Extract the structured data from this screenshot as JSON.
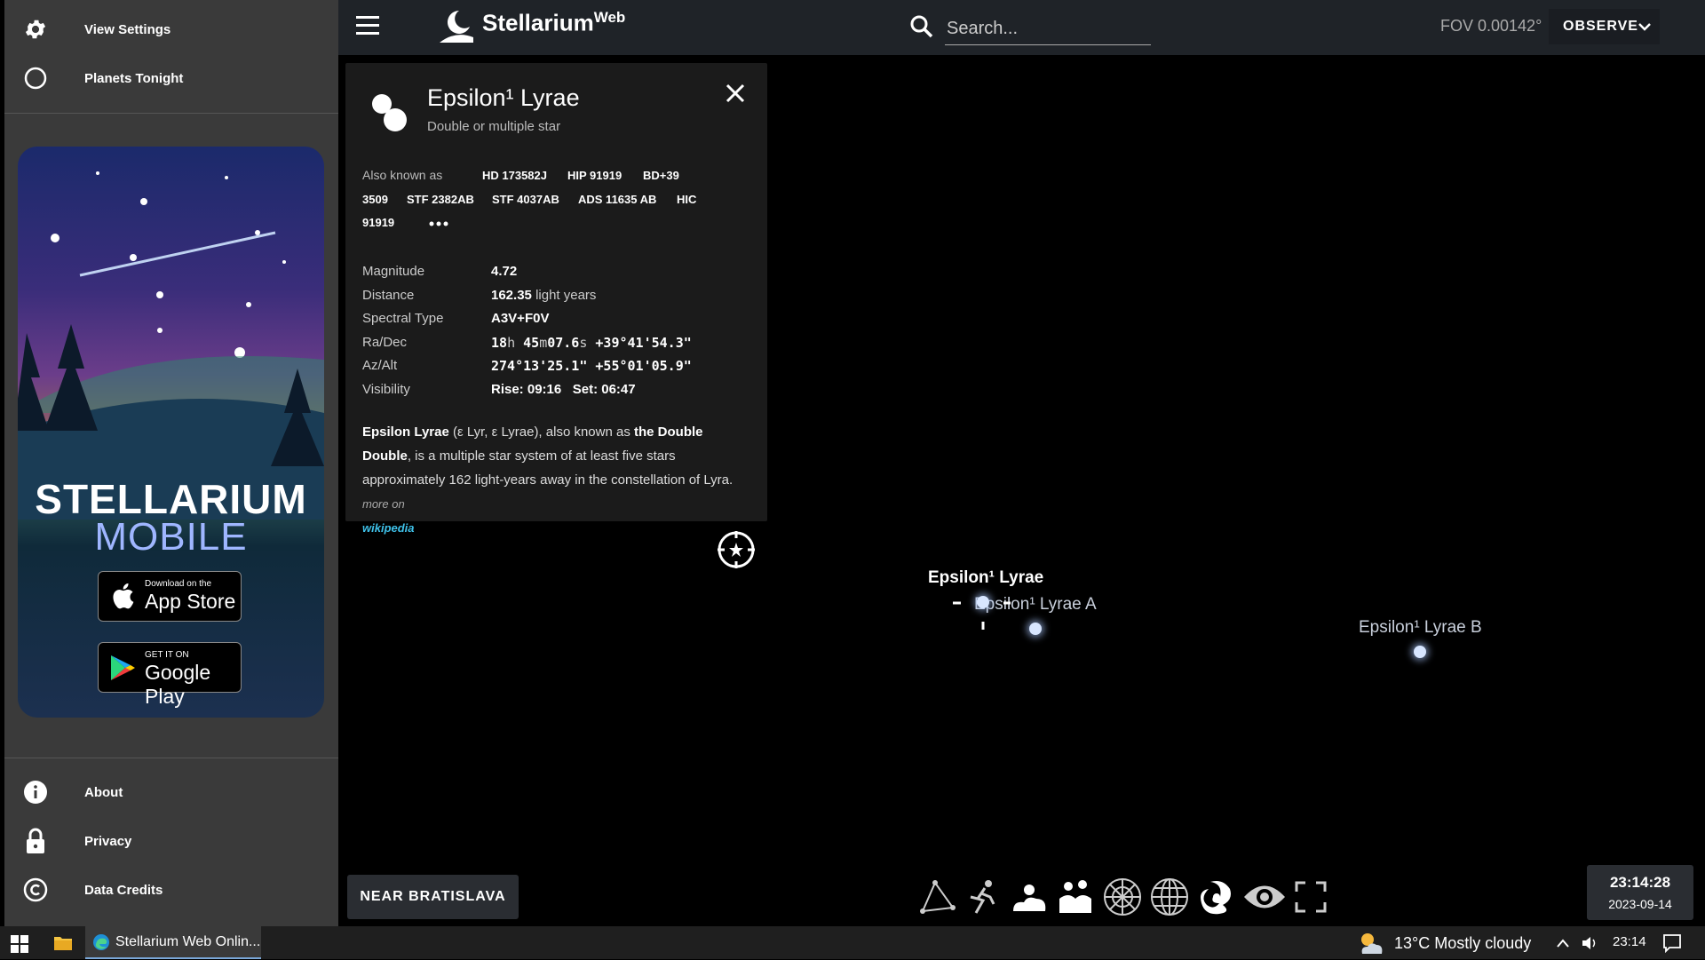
{
  "sidebar": {
    "top_items": [
      {
        "label": "View Settings",
        "icon": "gear-icon"
      },
      {
        "label": "Planets Tonight",
        "icon": "circle-icon"
      }
    ],
    "promo": {
      "title": "STELLARIUM",
      "subtitle": "MOBILE",
      "appstore_small": "Download on the",
      "appstore_big": "App Store",
      "googleplay_small": "GET IT ON",
      "googleplay_big": "Google Play"
    },
    "bottom_items": [
      {
        "label": "About",
        "icon": "info-icon"
      },
      {
        "label": "Privacy",
        "icon": "lock-icon"
      },
      {
        "label": "Data Credits",
        "icon": "copyright-icon"
      }
    ]
  },
  "header": {
    "logo": "Stellarium",
    "logo_sup": "Web",
    "search_placeholder": "Search...",
    "fov": "FOV 0.00142°",
    "observe_label": "OBSERVE"
  },
  "info": {
    "title": "Epsilon¹ Lyrae",
    "type": "Double or multiple star",
    "aka_label": "Also known as",
    "aka": [
      "HD 173582J",
      "HIP 91919",
      "BD+39",
      "3509",
      "STF 2382AB",
      "STF 4037AB",
      "ADS 11635 AB",
      "HIC",
      "91919"
    ],
    "props": {
      "magnitude_k": "Magnitude",
      "magnitude_v": "4.72",
      "distance_k": "Distance",
      "distance_v": "162.35",
      "distance_unit": "light years",
      "spectral_k": "Spectral Type",
      "spectral_v": "A3V+F0V",
      "radec_k": "Ra/Dec",
      "ra_h": "18",
      "ra_m": "45",
      "ra_s": "07.6",
      "dec": "+39°41'54.3\"",
      "azalt_k": "Az/Alt",
      "az": "274°13'25.1\"",
      "alt": "+55°01'05.9\"",
      "vis_k": "Visibility",
      "rise": "Rise: 09:16",
      "set": "Set: 06:47"
    },
    "desc": {
      "name": "Epsilon Lyrae",
      "part1": " (ε Lyr, ε Lyrae), also known as ",
      "bold2": "the Double Double",
      "part2": ", is a multiple star system of at least five stars approximately 162 light-years away in the constellation of Lyra. ",
      "more": "more on",
      "wiki": "wikipedia"
    }
  },
  "sky": {
    "label_main": "Epsilon¹ Lyrae",
    "label_a": "Epsilon¹ Lyrae A",
    "label_b": "Epsilon¹ Lyrae B"
  },
  "bottom": {
    "near_label": "NEAR BRATISLAVA",
    "time": "23:14:28",
    "date": "2023-09-14"
  },
  "taskbar": {
    "app_label": "Stellarium Web Onlin...",
    "weather": "13°C  Mostly cloudy",
    "time": "23:14"
  }
}
